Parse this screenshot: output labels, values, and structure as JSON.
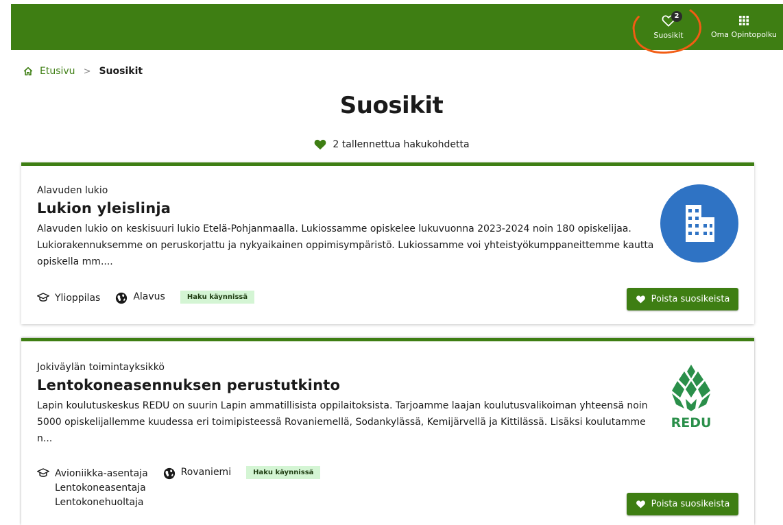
{
  "header": {
    "favorites_label": "Suosikit",
    "favorites_count": "2",
    "oma_label": "Oma Opintopolku"
  },
  "breadcrumb": {
    "home": "Etusivu",
    "current": "Suosikit"
  },
  "page": {
    "title": "Suosikit",
    "count_text": "2 tallennettua hakukohdetta"
  },
  "cards": [
    {
      "org": "Alavuden lukio",
      "title": "Lukion yleislinja",
      "description": "Alavuden lukio on keskisuuri lukio Etelä-Pohjanmaalla. Lukiossamme opiskelee lukuvuonna 2023-2024 noin 180 opiskelijaa. Lukiorakennuksemme on peruskorjattu ja nykyaikainen oppimisympäristö. Lukiossamme voi yhteistyökumppaneittemme kautta opiskella mm....",
      "degrees": [
        "Ylioppilas"
      ],
      "location": "Alavus",
      "status": "Haku käynnissä",
      "remove_label": "Poista suosikeista",
      "logo_icon": "building-icon"
    },
    {
      "org": "Jokiväylän toimintayksikkö",
      "title": "Lentokoneasennuksen perustutkinto",
      "description": "Lapin koulutuskeskus REDU on suurin Lapin ammatillisista oppilaitoksista. Tarjoamme laajan koulutusvalikoiman yhteensä noin 5000 opiskelijallemme kuudessa eri toimipisteessä Rovaniemellä, Sodankylässä, Kemijärvellä ja Kittilässä. Lisäksi koulutamme n...",
      "degrees": [
        "Avioniikka-asentaja",
        "Lentokoneasentaja",
        "Lentokonehuoltaja"
      ],
      "location": "Rovaniemi",
      "status": "Haku käynnissä",
      "remove_label": "Poista suosikeista",
      "logo_text": "REDU"
    }
  ],
  "colors": {
    "brand_green": "#3e7e13",
    "status_bg": "#d4f5d4",
    "logo_blue": "#2f73c4",
    "annotation": "#f25c13"
  }
}
